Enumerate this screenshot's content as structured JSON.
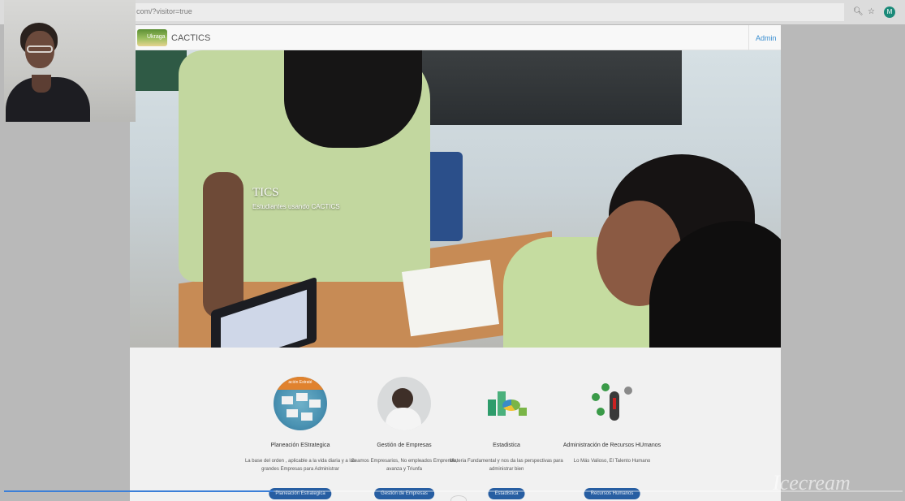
{
  "browser": {
    "url": "com/?visitor=true",
    "zoom_icon": "zoom-icon",
    "bookmark_icon": "star-icon",
    "profile_initial": "M"
  },
  "site": {
    "brand": "CACTICS",
    "logo_text": "Ukraga",
    "admin_link": "Admin"
  },
  "hero": {
    "title": "TICS",
    "subtitle": "Estudiantes usando CACTICS"
  },
  "features": [
    {
      "title": "Planeación EStrategica",
      "image_banner": "ación Estraté",
      "description": "La base del orden , aplicable a la vida diaria y a las grandes Empresas para Administrar",
      "button": "Planeación Estrategica"
    },
    {
      "title": "Gestión de Empresas",
      "description": "Seamos Empresarios, No empleados Emprende, avanza y Triunfa",
      "button": "Gestión de Empresas"
    },
    {
      "title": "Estadistica",
      "description": "Materia Fundamental y nos da las perspectivas para administrar bien",
      "button": "Estadistica"
    },
    {
      "title": "Administración de Recursos HUmanos",
      "description": "Lo Más Valioso, El Talento Humano",
      "button": "Recursos Humanos"
    }
  ],
  "video": {
    "progress": 0.3,
    "watermark": "Icecream"
  },
  "colors": {
    "accent_button": "#275ea2",
    "admin_link": "#3a8ed0",
    "progress": "#3b7fd8"
  }
}
